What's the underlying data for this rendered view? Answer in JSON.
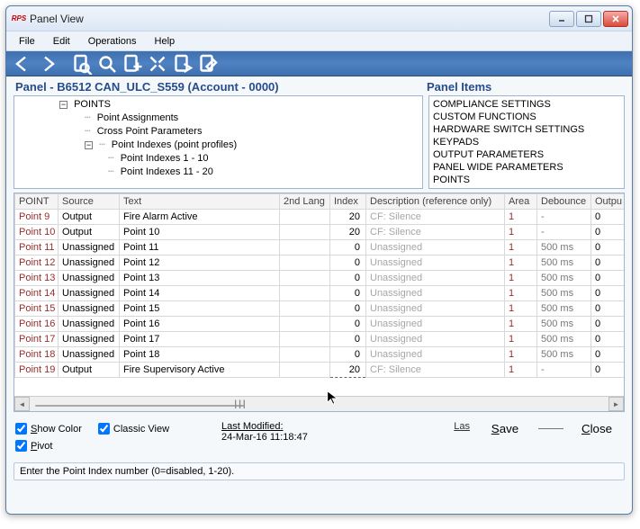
{
  "window": {
    "app_icon_label": "RPS",
    "title": "Panel View"
  },
  "menu": {
    "file": "File",
    "edit": "Edit",
    "operations": "Operations",
    "help": "Help"
  },
  "toolbar_icons": [
    "back",
    "forward",
    "find-doc",
    "search",
    "page-add",
    "tools",
    "page-arrow",
    "edit-page"
  ],
  "header": {
    "panel_title": "Panel - B6512 CAN_ULC_S559 (Account - 0000)",
    "panel_items_title": "Panel Items"
  },
  "tree": {
    "root": "POINTS",
    "children": [
      "Point Assignments",
      "Cross Point Parameters"
    ],
    "indexes_label": "Point Indexes (point profiles)",
    "index_children": [
      "Point Indexes 1 - 10",
      "Point Indexes 11 - 20"
    ]
  },
  "panel_items": [
    "COMPLIANCE SETTINGS",
    "CUSTOM FUNCTIONS",
    "HARDWARE SWITCH SETTINGS",
    "KEYPADS",
    "OUTPUT PARAMETERS",
    "PANEL WIDE PARAMETERS",
    "POINTS"
  ],
  "columns": {
    "point": "POINT",
    "source": "Source",
    "text": "Text",
    "lang": "2nd Lang",
    "index": "Index",
    "desc": "Description (reference only)",
    "area": "Area",
    "debounce": "Debounce",
    "output": "Outpu"
  },
  "rows": [
    {
      "point": "Point 9",
      "source": "Output",
      "text": "Fire Alarm Active",
      "lang": "",
      "index": "20",
      "desc": "CF: Silence",
      "area": "1",
      "debounce": "-",
      "output": "0"
    },
    {
      "point": "Point 10",
      "source": "Output",
      "text": "Point 10",
      "lang": "",
      "index": "20",
      "desc": "CF: Silence",
      "area": "1",
      "debounce": "-",
      "output": "0"
    },
    {
      "point": "Point 11",
      "source": "Unassigned",
      "text": "Point 11",
      "lang": "",
      "index": "0",
      "desc": "Unassigned",
      "area": "1",
      "debounce": "500 ms",
      "output": "0"
    },
    {
      "point": "Point 12",
      "source": "Unassigned",
      "text": "Point 12",
      "lang": "",
      "index": "0",
      "desc": "Unassigned",
      "area": "1",
      "debounce": "500 ms",
      "output": "0"
    },
    {
      "point": "Point 13",
      "source": "Unassigned",
      "text": "Point 13",
      "lang": "",
      "index": "0",
      "desc": "Unassigned",
      "area": "1",
      "debounce": "500 ms",
      "output": "0"
    },
    {
      "point": "Point 14",
      "source": "Unassigned",
      "text": "Point 14",
      "lang": "",
      "index": "0",
      "desc": "Unassigned",
      "area": "1",
      "debounce": "500 ms",
      "output": "0"
    },
    {
      "point": "Point 15",
      "source": "Unassigned",
      "text": "Point 15",
      "lang": "",
      "index": "0",
      "desc": "Unassigned",
      "area": "1",
      "debounce": "500 ms",
      "output": "0"
    },
    {
      "point": "Point 16",
      "source": "Unassigned",
      "text": "Point 16",
      "lang": "",
      "index": "0",
      "desc": "Unassigned",
      "area": "1",
      "debounce": "500 ms",
      "output": "0"
    },
    {
      "point": "Point 17",
      "source": "Unassigned",
      "text": "Point 17",
      "lang": "",
      "index": "0",
      "desc": "Unassigned",
      "area": "1",
      "debounce": "500 ms",
      "output": "0"
    },
    {
      "point": "Point 18",
      "source": "Unassigned",
      "text": "Point 18",
      "lang": "",
      "index": "0",
      "desc": "Unassigned",
      "area": "1",
      "debounce": "500 ms",
      "output": "0"
    },
    {
      "point": "Point 19",
      "source": "Output",
      "text": "Fire Supervisory Active",
      "lang": "",
      "index": "20",
      "desc": "CF: Silence",
      "area": "1",
      "debounce": "-",
      "output": "0",
      "selected": true
    }
  ],
  "options": {
    "show_color": "Show Color",
    "classic_view": "Classic View",
    "pivot": "Pivot",
    "show_color_checked": true,
    "classic_view_checked": true,
    "pivot_checked": true
  },
  "last_modified": {
    "label": "Last Modified:",
    "value": "24-Mar-16 11:18:47",
    "las": "Las"
  },
  "buttons": {
    "save": "Save",
    "close": "Close"
  },
  "status_text": "Enter the Point Index number (0=disabled, 1-20)."
}
